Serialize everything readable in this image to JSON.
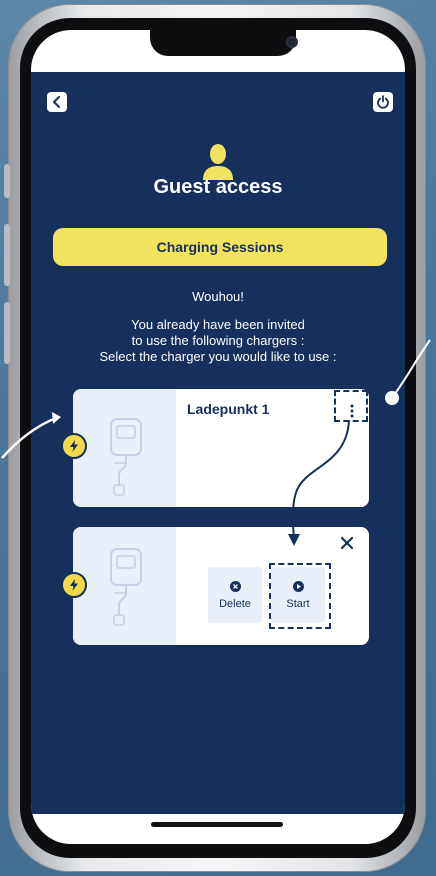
{
  "header": {
    "back_icon": "chevron-left-icon",
    "power_icon": "power-icon",
    "avatar_icon": "user-icon",
    "title": "Guest access"
  },
  "tab": {
    "label": "Charging Sessions"
  },
  "message": {
    "line1": "Wouhou!",
    "line2": "You already have been invited",
    "line3": "to use the following chargers :",
    "line4": "Select the charger you would like to use :"
  },
  "chargers": [
    {
      "name": "Ladepunkt 1",
      "menu_icon": "more-vertical-icon",
      "status_icon": "bolt-icon"
    }
  ],
  "action_card": {
    "close_icon": "close-icon",
    "delete_label": "Delete",
    "start_label": "Start"
  },
  "colors": {
    "app_background": "#15305c",
    "accent_yellow": "#f2e35e",
    "card_left": "#e9eff9"
  }
}
